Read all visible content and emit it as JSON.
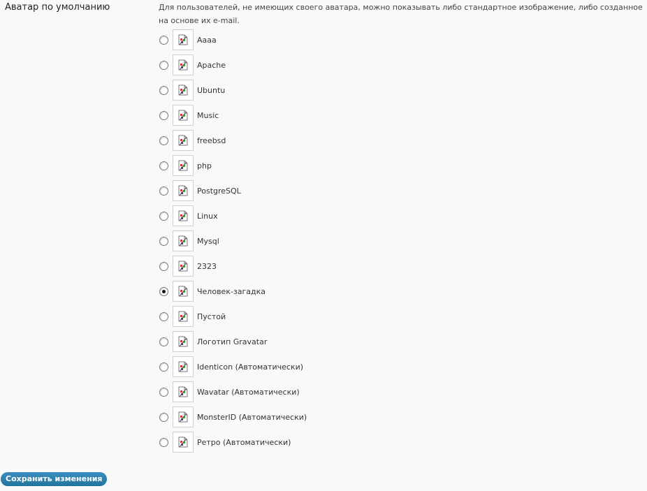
{
  "setting": {
    "label": "Аватар по умолчанию",
    "description": "Для пользователей, не имеющих своего аватара, можно показывать либо стандартное изображение, либо созданное на основе их e-mail."
  },
  "options": [
    {
      "label": "Аааа",
      "checked": false
    },
    {
      "label": "Apache",
      "checked": false
    },
    {
      "label": "Ubuntu",
      "checked": false
    },
    {
      "label": "Music",
      "checked": false
    },
    {
      "label": "freebsd",
      "checked": false
    },
    {
      "label": "php",
      "checked": false
    },
    {
      "label": "PostgreSQL",
      "checked": false
    },
    {
      "label": "Linux",
      "checked": false
    },
    {
      "label": "Mysql",
      "checked": false
    },
    {
      "label": "2323",
      "checked": false
    },
    {
      "label": "Человек-загадка",
      "checked": true
    },
    {
      "label": "Пустой",
      "checked": false
    },
    {
      "label": "Логотип Gravatar",
      "checked": false
    },
    {
      "label": "Identicon (Автоматически)",
      "checked": false
    },
    {
      "label": "Wavatar (Автоматически)",
      "checked": false
    },
    {
      "label": "MonsterID (Автоматически)",
      "checked": false
    },
    {
      "label": "Ретро (Автоматически)",
      "checked": false
    }
  ],
  "thumbnail_icon": "broken-image-icon",
  "save_label": "Сохранить изменения",
  "colors": {
    "button": "#21759b",
    "background": "#f9f9f9"
  }
}
